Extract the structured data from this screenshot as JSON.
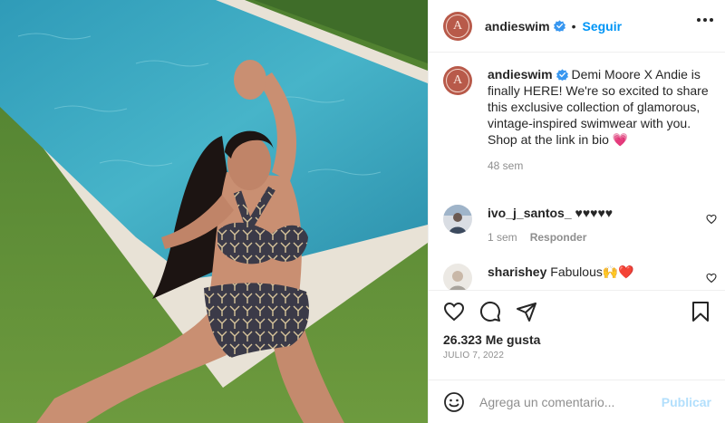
{
  "post": {
    "image": {
      "scene": "woman in swimsuit posing beside a pool on grass",
      "colors": {
        "grass": "#5e8a38",
        "water": "#3aa7c0",
        "coping": "#e8e2d6"
      }
    },
    "author": {
      "username": "andieswim",
      "verified": true,
      "avatar_letter": "A",
      "avatar_color": "#b85a4a"
    },
    "follow_label": "Seguir",
    "separator": "•",
    "more_icon": "more-horizontal-icon"
  },
  "caption": {
    "username": "andieswim",
    "text": "Demi Moore X Andie is finally HERE! We're so excited to share this exclusive collection of glamorous, vintage-inspired swimwear with you. Shop at the link in bio 💗",
    "time": "48 sem"
  },
  "comments": [
    {
      "username": "ivo_j_santos_",
      "text": "♥♥♥♥♥",
      "time": "1 sem",
      "reply_label": "Responder"
    },
    {
      "username": "sharishey",
      "text": "Fabulous🙌❤️"
    }
  ],
  "actions": {
    "like_icon": "heart-icon",
    "comment_icon": "comment-icon",
    "share_icon": "share-icon",
    "save_icon": "bookmark-icon"
  },
  "likes": "26.323 Me gusta",
  "date": "JULIO 7, 2022",
  "add_comment": {
    "emoji_icon": "emoji-icon",
    "placeholder": "Agrega un comentario...",
    "publish_label": "Publicar"
  },
  "accent_color": "#0095f6"
}
